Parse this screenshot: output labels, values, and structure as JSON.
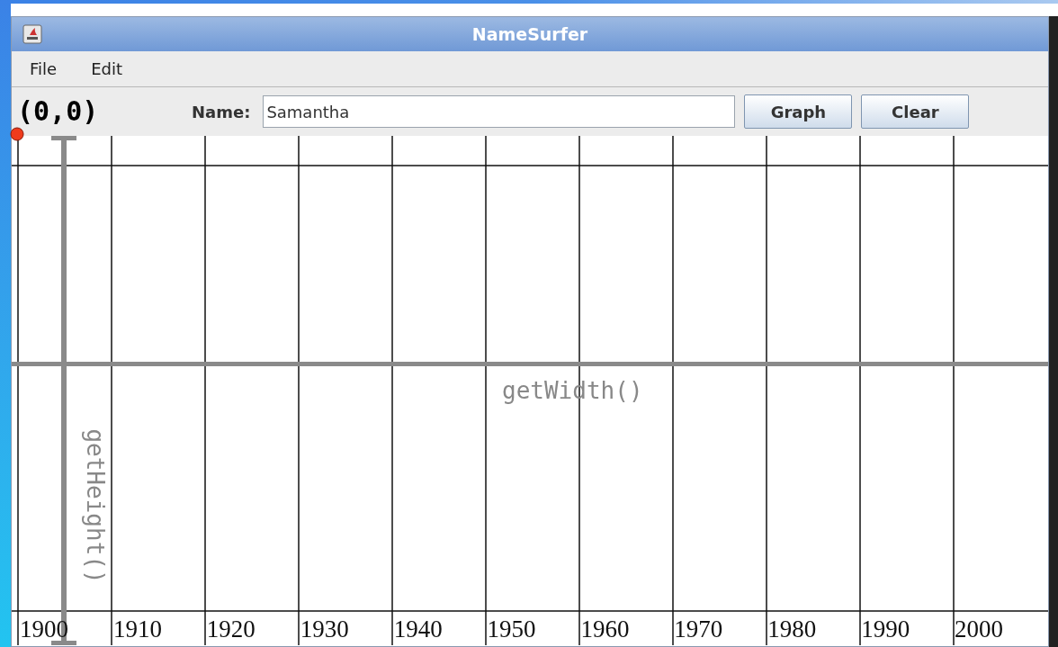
{
  "window": {
    "title": "NameSurfer"
  },
  "menu": [
    "File",
    "Edit"
  ],
  "toolbar": {
    "label": "Name:",
    "field_value": "Samantha",
    "buttons": [
      "Graph",
      "Clear"
    ]
  },
  "graph": {
    "decades": [
      "1900",
      "1910",
      "1920",
      "1930",
      "1940",
      "1950",
      "1960",
      "1970",
      "1980",
      "1990",
      "2000"
    ]
  },
  "annotations": {
    "origin": "(0,0)",
    "width_label": "getWidth()",
    "height_label": "getHeight()"
  }
}
